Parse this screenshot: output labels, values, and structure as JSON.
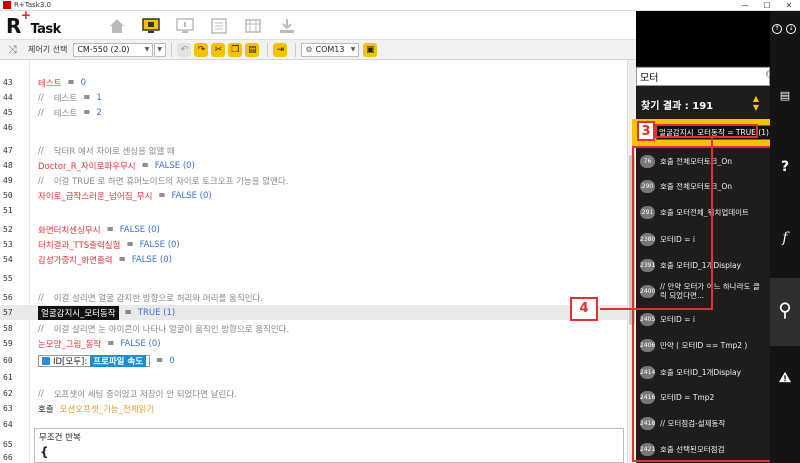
{
  "window": {
    "title": "R+Task3.0",
    "controls": [
      "—",
      "☐",
      "✕"
    ]
  },
  "app": {
    "logo_main": "R",
    "logo_plus": "+",
    "logo_task": "Task"
  },
  "toolbar": {
    "controller_label": "제어기 선택",
    "controller_value": "CM-550 (2.0)",
    "port_value": "COM13"
  },
  "editor": {
    "lines": [
      {
        "n": "43",
        "var": "테스트",
        "eq": "=",
        "val": "0"
      },
      {
        "n": "44",
        "com": "//",
        "text": "테스트",
        "eq": "=",
        "val": "1"
      },
      {
        "n": "45",
        "com": "//",
        "text": "테스트",
        "eq": "=",
        "val": "2"
      },
      {
        "n": "46"
      },
      {
        "n": "47",
        "com": "//",
        "comment": "닥터R 에서 자이로 센싱을 없앨 때"
      },
      {
        "n": "48",
        "var": "Doctor_R_자이로파우무시",
        "eq": "=",
        "val": "FALSE (0)"
      },
      {
        "n": "49",
        "com": "//",
        "comment": "이걸 TRUE 로 하면 휴머노이드의 자이로 토크오프 기능을 없앤다."
      },
      {
        "n": "50",
        "var": "자이로_급작스러운_넘어짐_무시",
        "eq": "=",
        "val": "FALSE (0)"
      },
      {
        "n": "51"
      },
      {
        "n": "52",
        "var": "화면터치센싱무시",
        "eq": "=",
        "val": "FALSE (0)"
      },
      {
        "n": "53",
        "var": "터치결과_TTS출력실험",
        "eq": "=",
        "val": "FALSE (0)"
      },
      {
        "n": "54",
        "var": "감성가중치_화면출력",
        "eq": "=",
        "val": "FALSE (0)"
      },
      {
        "n": "55"
      },
      {
        "n": "56",
        "com": "//",
        "comment": "이걸 살리면 얼굴 감지한 방향으로 허리와 머리를 움직인다."
      },
      {
        "n": "57",
        "boxed": "얼굴감지시_모터동작",
        "eq": "=",
        "val": "TRUE (1)"
      },
      {
        "n": "58",
        "com": "//",
        "comment": "이걸 살리면 눈 아이콘이 나타나 얼굴이 움직인 방향으로 움직인다."
      },
      {
        "n": "59",
        "var": "눈모양_그림_동작",
        "eq": "=",
        "val": "FALSE (0)"
      },
      {
        "n": "60",
        "id_label": "ID[모두]:",
        "profile": "프로파일 속도",
        "eq": "=",
        "val": "0"
      },
      {
        "n": "61"
      },
      {
        "n": "62",
        "com": "//",
        "comment": "오프셋이 세팅 중이었고 저장이 안 되었다면 날린다."
      },
      {
        "n": "63",
        "kw": "호출",
        "fn": "모션오프셋_기능_전체읽기"
      },
      {
        "n": "64"
      },
      {
        "n": "65"
      },
      {
        "n": "66"
      }
    ],
    "loop_title": "무조건 반복",
    "loop_brace": "{"
  },
  "search": {
    "query": "모터",
    "result_label": "찾기 결과 : 191",
    "up": "▲",
    "down": "▼",
    "selected": "얼굴감지시_모터동작 = TRUE (1)",
    "results": [
      {
        "line": "76",
        "text": "호출 전체모터토크_On"
      },
      {
        "line": "290",
        "text": "호출 전체모터토크_On"
      },
      {
        "line": "291",
        "text": "호출 모터전체_위치업데이트"
      },
      {
        "line": "2380",
        "text": "모터ID = i"
      },
      {
        "line": "2391",
        "text": "호출 모터ID_1개Display"
      },
      {
        "line": "2400",
        "text": "// 만약 모터가 어느 하나라도 클릭 되었다면..."
      },
      {
        "line": "2405",
        "text": "모터ID = i"
      },
      {
        "line": "2406",
        "text": "만약 ( 모터ID == Tmp2 )"
      },
      {
        "line": "2414",
        "text": "호출 모터ID_1개Display"
      },
      {
        "line": "2416",
        "text": "모터ID = Tmp2"
      },
      {
        "line": "2418",
        "text": "// 모터점검-설제동작"
      },
      {
        "line": "2421",
        "text": "호출 선택된모터점검"
      }
    ]
  },
  "callouts": {
    "c3": "3",
    "c4": "4"
  },
  "rail": {
    "f": "f",
    "q": "?",
    "warn": "!"
  }
}
